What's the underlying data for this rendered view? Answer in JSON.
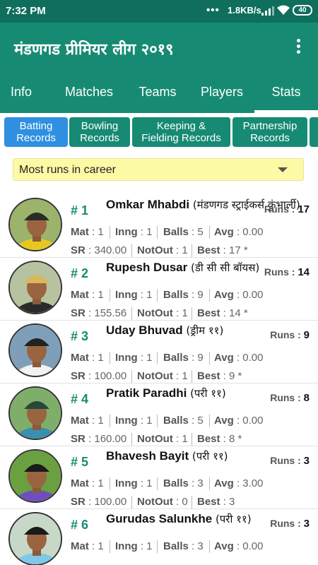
{
  "status_bar": {
    "time": "7:32 PM",
    "dots": "•••",
    "speed": "1.8KB/s",
    "battery": "40"
  },
  "app": {
    "title": "मंडणगड प्रीमियर लीग २०१९"
  },
  "tabs": [
    {
      "label": "Info"
    },
    {
      "label": "Matches"
    },
    {
      "label": "Teams"
    },
    {
      "label": "Players"
    },
    {
      "label": "Stats"
    }
  ],
  "active_tab": "Stats",
  "subtabs": [
    {
      "line1": "Batting",
      "line2": "Records"
    },
    {
      "line1": "Bowling",
      "line2": "Records"
    },
    {
      "line1": "Keeping &",
      "line2": "Fielding Records"
    },
    {
      "line1": "Partnership",
      "line2": "Records"
    }
  ],
  "dropdown": {
    "value": "Most runs in career"
  },
  "labels": {
    "runs": "Runs",
    "mat": "Mat",
    "inng": "Inng",
    "balls": "Balls",
    "avg": "Avg",
    "sr": "SR",
    "notout": "NotOut",
    "best": "Best"
  },
  "players": [
    {
      "rank": "# 1",
      "name": "Omkar Mhabdi",
      "team": "(मंडणगड स्ट्राईकर्स कुंभार्ली)",
      "runs": "17",
      "mat": "1",
      "inng": "1",
      "balls": "5",
      "avg": "0.00",
      "sr": "340.00",
      "notout": "1",
      "best": "17 *",
      "colors": {
        "shirt": "#e8c820",
        "bg": "#9bb36a",
        "cap": "#2a2a2a"
      }
    },
    {
      "rank": "# 2",
      "name": "Rupesh Dusar",
      "team": "(डी सी सी बॉयस)",
      "runs": "14",
      "mat": "1",
      "inng": "1",
      "balls": "9",
      "avg": "0.00",
      "sr": "155.56",
      "notout": "1",
      "best": "14 *",
      "colors": {
        "shirt": "#2a2a2a",
        "bg": "#b7c2a0",
        "cap": "#d9b85a"
      }
    },
    {
      "rank": "# 3",
      "name": "Uday Bhuvad",
      "team": "(ड्रीम ११)",
      "runs": "9",
      "mat": "1",
      "inng": "1",
      "balls": "9",
      "avg": "0.00",
      "sr": "100.00",
      "notout": "1",
      "best": "9 *",
      "colors": {
        "shirt": "#f2f2f2",
        "bg": "#7f9fb8",
        "cap": "#222222"
      }
    },
    {
      "rank": "# 4",
      "name": "Pratik Paradhi",
      "team": "(परी ११)",
      "runs": "8",
      "mat": "1",
      "inng": "1",
      "balls": "5",
      "avg": "0.00",
      "sr": "160.00",
      "notout": "1",
      "best": "8 *",
      "colors": {
        "shirt": "#3a8fb0",
        "bg": "#7fae6a",
        "cap": "#26483a"
      }
    },
    {
      "rank": "# 5",
      "name": "Bhavesh Bayit",
      "team": "(परी ११)",
      "runs": "3",
      "mat": "1",
      "inng": "1",
      "balls": "3",
      "avg": "3.00",
      "sr": "100.00",
      "notout": "0",
      "best": "3",
      "colors": {
        "shirt": "#6f4fc0",
        "bg": "#6aa040",
        "cap": "#1a1a1a"
      }
    },
    {
      "rank": "# 6",
      "name": "Gurudas Salunkhe",
      "team": "(परी ११)",
      "runs": "3",
      "mat": "1",
      "inng": "1",
      "balls": "3",
      "avg": "0.00",
      "sr": "",
      "notout": "",
      "best": "",
      "colors": {
        "shirt": "#7fc8e8",
        "bg": "#c8d8c8",
        "cap": "#1a1a1a"
      }
    }
  ]
}
